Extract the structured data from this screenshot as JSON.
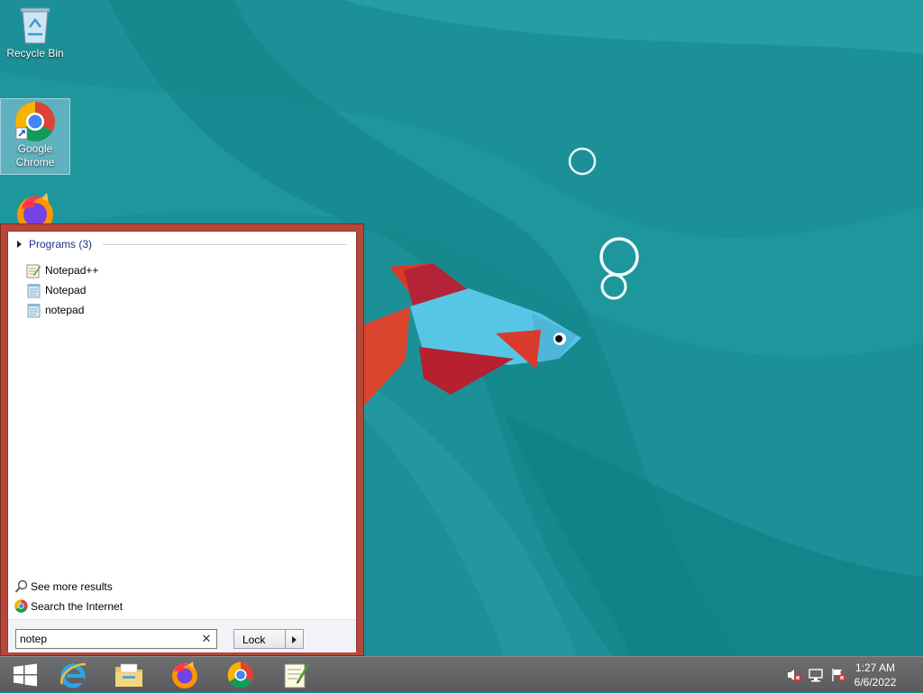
{
  "desktop": {
    "icons": [
      {
        "label": "Recycle Bin",
        "icon": "recycle-bin-icon"
      },
      {
        "label": "Google Chrome",
        "icon": "chrome-icon"
      },
      {
        "label": "",
        "icon": "firefox-icon"
      }
    ]
  },
  "start_menu": {
    "group": {
      "label": "Programs (3)"
    },
    "results": [
      {
        "label": "Notepad++",
        "icon": "notepad-plus-plus-icon"
      },
      {
        "label": "Notepad",
        "icon": "notepad-icon"
      },
      {
        "label": "notepad",
        "icon": "notepad-icon"
      }
    ],
    "see_more": "See more results",
    "search_internet": "Search the Internet",
    "search": {
      "value": "notep"
    },
    "lock_label": "Lock"
  },
  "taskbar": {
    "apps": [
      "start-icon",
      "internet-explorer-icon",
      "file-explorer-icon",
      "firefox-icon",
      "chrome-icon",
      "notepad-plus-plus-icon"
    ],
    "clock": {
      "time": "1:27 AM",
      "date": "6/6/2022"
    }
  },
  "colors": {
    "start_border": "#b7473a",
    "taskbar": "#5a5b5c",
    "wallpaper": "#1a8f94",
    "group_header": "#1e3287"
  }
}
